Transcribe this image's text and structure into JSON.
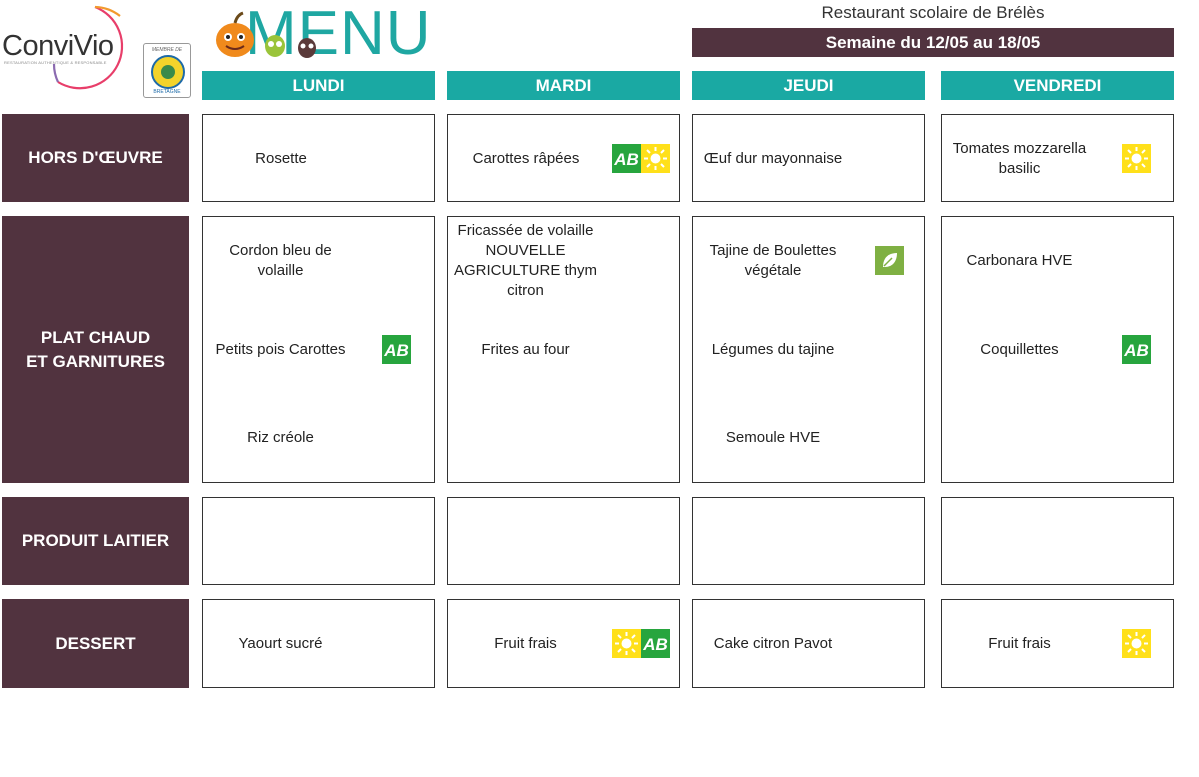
{
  "header": {
    "brand": "ConviVio",
    "brand_tagline": "RESTAURATION AUTHENTIQUE & RESPONSABLE",
    "badge_top": "MEMBRE DE",
    "badge_bottom": "BRETAGNE",
    "title": "MENU",
    "restaurant": "Restaurant scolaire de Brélès",
    "week": "Semaine du 12/05 au 18/05"
  },
  "days": [
    "LUNDI",
    "MARDI",
    "JEUDI",
    "VENDREDI"
  ],
  "rows": [
    {
      "label_line1": "HORS D'ŒUVRE",
      "label_line2": ""
    },
    {
      "label_line1": "PLAT CHAUD",
      "label_line2": "ET GARNITURES"
    },
    {
      "label_line1": "PRODUIT LAITIER",
      "label_line2": ""
    },
    {
      "label_line1": "DESSERT",
      "label_line2": ""
    }
  ],
  "menu": {
    "hors_doeuvre": {
      "lundi": "Rosette",
      "mardi": "Carottes râpées",
      "jeudi": "Œuf dur mayonnaise",
      "vendredi_l1": "Tomates mozzarella",
      "vendredi_l2": "basilic"
    },
    "plat": {
      "lundi_main_l1": "Cordon bleu de",
      "lundi_main_l2": "volaille",
      "lundi_side1": "Petits pois Carottes",
      "lundi_side2": "Riz créole",
      "mardi_main_l1": "Fricassée de volaille",
      "mardi_main_l2": "NOUVELLE",
      "mardi_main_l3": "AGRICULTURE thym",
      "mardi_main_l4": "citron",
      "mardi_side1": "Frites au four",
      "jeudi_main_l1": "Tajine de Boulettes",
      "jeudi_main_l2": "végétale",
      "jeudi_side1": "Légumes du tajine",
      "jeudi_side2": "Semoule HVE",
      "vendredi_main": "Carbonara HVE",
      "vendredi_side1": "Coquillettes"
    },
    "dessert": {
      "lundi": "Yaourt sucré",
      "mardi": "Fruit frais",
      "jeudi": "Cake citron Pavot",
      "vendredi": "Fruit frais"
    }
  },
  "labels": {
    "ab": "AB",
    "icons": [
      "ab-bio-icon",
      "sun-local-icon",
      "leaf-vegetarian-icon"
    ]
  },
  "colors": {
    "accent_teal": "#1aa9a3",
    "brand_plum": "#51333f",
    "bio_green": "#27a53e",
    "sun_yellow": "#ffe01a",
    "leaf_green": "#7fb043"
  }
}
